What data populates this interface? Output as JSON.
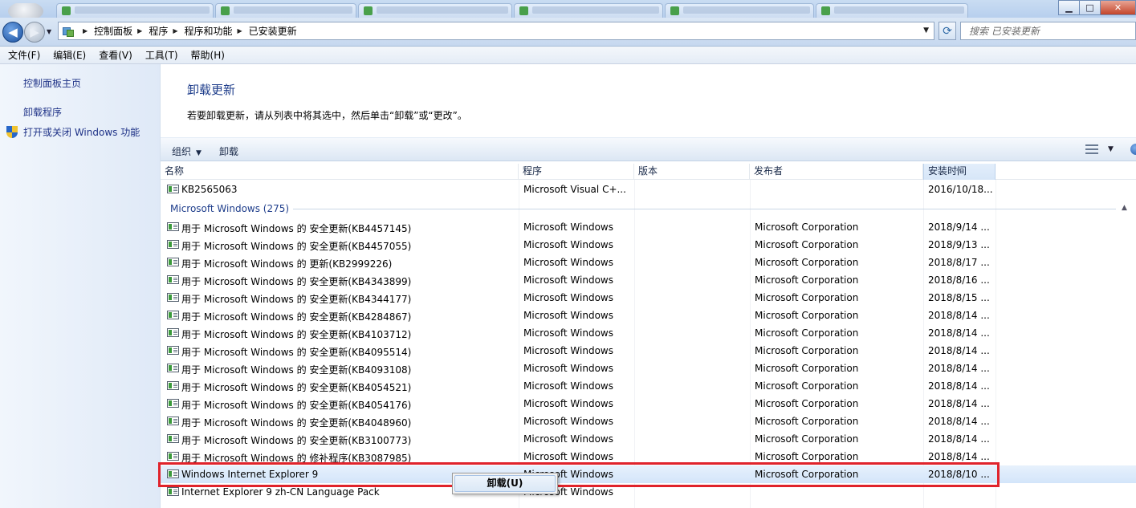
{
  "window": {
    "minimize": "▁",
    "maximize": "□",
    "close": "✕"
  },
  "nav": {
    "back_glyph": "◀",
    "forward_glyph": "▶",
    "dropdown_glyph": "▼",
    "refresh_glyph": "⟳"
  },
  "address": {
    "breadcrumbs": [
      "控制面板",
      "程序",
      "程序和功能",
      "已安装更新"
    ],
    "separator": "▶"
  },
  "search": {
    "placeholder": "搜索 已安装更新"
  },
  "menu": [
    "文件(F)",
    "编辑(E)",
    "查看(V)",
    "工具(T)",
    "帮助(H)"
  ],
  "left_pane": {
    "home": "控制面板主页",
    "uninstall": "卸载程序",
    "features": "打开或关闭 Windows 功能"
  },
  "main": {
    "title": "卸载更新",
    "description": "若要卸载更新，请从列表中将其选中，然后单击“卸载”或“更改”。"
  },
  "toolbar": {
    "organize": "组织",
    "uninstall": "卸载",
    "dropdown_glyph": "▼"
  },
  "columns": [
    "名称",
    "程序",
    "版本",
    "发布者",
    "安装时间"
  ],
  "sort_glyph": "▲",
  "top_row": {
    "name": "KB2565063",
    "program": "Microsoft Visual C+...",
    "version": "",
    "publisher": "",
    "date": "2016/10/18..."
  },
  "group": {
    "label": "Microsoft Windows (275)",
    "toggle": "▲"
  },
  "rows": [
    {
      "name": "用于 Microsoft Windows 的 安全更新(KB4457145)",
      "program": "Microsoft Windows",
      "publisher": "Microsoft Corporation",
      "date": "2018/9/14 ..."
    },
    {
      "name": "用于 Microsoft Windows 的 安全更新(KB4457055)",
      "program": "Microsoft Windows",
      "publisher": "Microsoft Corporation",
      "date": "2018/9/13 ..."
    },
    {
      "name": "用于 Microsoft Windows 的 更新(KB2999226)",
      "program": "Microsoft Windows",
      "publisher": "Microsoft Corporation",
      "date": "2018/8/17 ..."
    },
    {
      "name": "用于 Microsoft Windows 的 安全更新(KB4343899)",
      "program": "Microsoft Windows",
      "publisher": "Microsoft Corporation",
      "date": "2018/8/16 ..."
    },
    {
      "name": "用于 Microsoft Windows 的 安全更新(KB4344177)",
      "program": "Microsoft Windows",
      "publisher": "Microsoft Corporation",
      "date": "2018/8/15 ..."
    },
    {
      "name": "用于 Microsoft Windows 的 安全更新(KB4284867)",
      "program": "Microsoft Windows",
      "publisher": "Microsoft Corporation",
      "date": "2018/8/14 ..."
    },
    {
      "name": "用于 Microsoft Windows 的 安全更新(KB4103712)",
      "program": "Microsoft Windows",
      "publisher": "Microsoft Corporation",
      "date": "2018/8/14 ..."
    },
    {
      "name": "用于 Microsoft Windows 的 安全更新(KB4095514)",
      "program": "Microsoft Windows",
      "publisher": "Microsoft Corporation",
      "date": "2018/8/14 ..."
    },
    {
      "name": "用于 Microsoft Windows 的 安全更新(KB4093108)",
      "program": "Microsoft Windows",
      "publisher": "Microsoft Corporation",
      "date": "2018/8/14 ..."
    },
    {
      "name": "用于 Microsoft Windows 的 安全更新(KB4054521)",
      "program": "Microsoft Windows",
      "publisher": "Microsoft Corporation",
      "date": "2018/8/14 ..."
    },
    {
      "name": "用于 Microsoft Windows 的 安全更新(KB4054176)",
      "program": "Microsoft Windows",
      "publisher": "Microsoft Corporation",
      "date": "2018/8/14 ..."
    },
    {
      "name": "用于 Microsoft Windows 的 安全更新(KB4048960)",
      "program": "Microsoft Windows",
      "publisher": "Microsoft Corporation",
      "date": "2018/8/14 ..."
    },
    {
      "name": "用于 Microsoft Windows 的 安全更新(KB3100773)",
      "program": "Microsoft Windows",
      "publisher": "Microsoft Corporation",
      "date": "2018/8/14 ..."
    },
    {
      "name": "用于 Microsoft Windows 的 修补程序(KB3087985)",
      "program": "Microsoft Windows",
      "publisher": "Microsoft Corporation",
      "date": "2018/8/14 ..."
    },
    {
      "name": "Windows Internet Explorer 9",
      "program": "Microsoft Windows",
      "publisher": "Microsoft Corporation",
      "date": "2018/8/10 ..."
    },
    {
      "name": "Internet Explorer 9 zh-CN Language Pack",
      "program": "Microsoft Windows",
      "publisher": "",
      "date": ""
    }
  ],
  "selected_index": 14,
  "context_menu": {
    "uninstall": "卸载(U)"
  },
  "colors": {
    "link": "#1e3287",
    "title": "#1e3d8b",
    "highlight": "#e0232b"
  }
}
